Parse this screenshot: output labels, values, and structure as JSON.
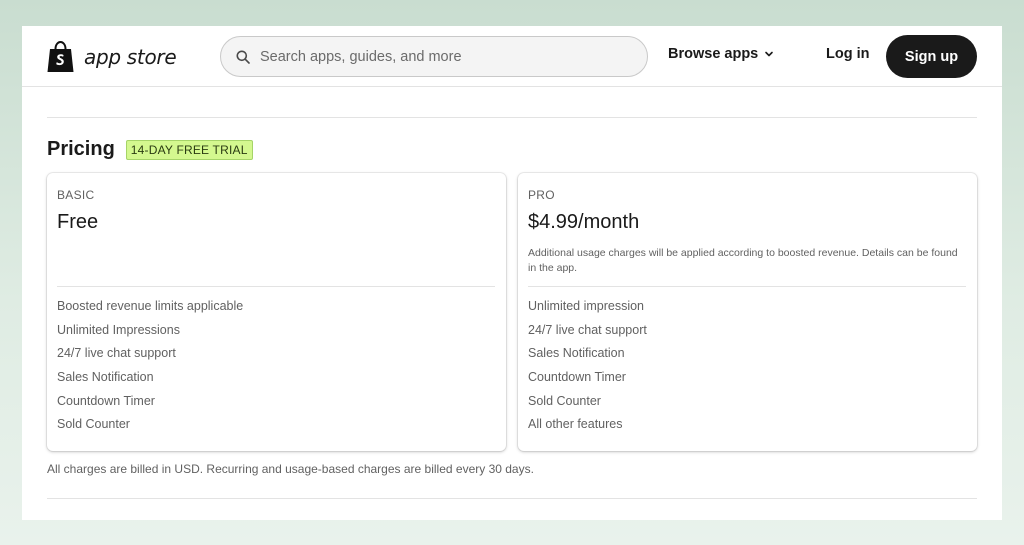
{
  "header": {
    "logo_text": "app store",
    "search_placeholder": "Search apps, guides, and more",
    "browse_label": "Browse apps",
    "login_label": "Log in",
    "signup_label": "Sign up"
  },
  "pricing": {
    "title": "Pricing",
    "badge": "14-DAY FREE TRIAL",
    "plans": [
      {
        "name": "BASIC",
        "price": "Free",
        "note": "",
        "features": [
          "Boosted revenue limits applicable",
          "Unlimited Impressions",
          "24/7 live chat support",
          "Sales Notification",
          "Countdown Timer",
          "Sold Counter"
        ]
      },
      {
        "name": "PRO",
        "price": "$4.99/month",
        "note": "Additional usage charges will be applied according to boosted revenue. Details can be found in the app.",
        "features": [
          "Unlimited impression",
          "24/7 live chat support",
          "Sales Notification",
          "Countdown Timer",
          "Sold Counter",
          "All other features"
        ]
      }
    ],
    "footnote": "All charges are billed in USD. Recurring and usage-based charges are billed every 30 days."
  },
  "colors": {
    "badge_bg": "#d4f88f",
    "signup_bg": "#1a1a1a",
    "logo_green": "#95bf47"
  }
}
